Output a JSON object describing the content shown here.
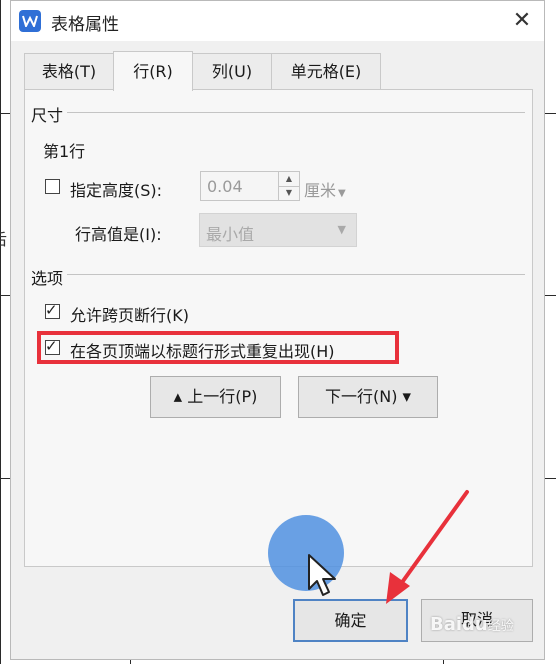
{
  "dialog": {
    "title": "表格属性",
    "app_icon": "wps-writer-icon",
    "close_glyph": "✕"
  },
  "tabs": [
    {
      "label": "表格(T)",
      "active": false
    },
    {
      "label": "行(R)",
      "active": true
    },
    {
      "label": "列(U)",
      "active": false
    },
    {
      "label": "单元格(E)",
      "active": false
    }
  ],
  "size_section": {
    "title": "尺寸",
    "row_label": "第1行",
    "specify_height": {
      "label": "指定高度(S):",
      "checked": false
    },
    "height_value": "0.04",
    "unit": "厘米",
    "row_height_mode": {
      "label": "行高值是(I):",
      "value": "最小值"
    }
  },
  "options_section": {
    "title": "选项",
    "allow_break": {
      "label": "允许跨页断行(K)",
      "checked": true
    },
    "repeat_header": {
      "label": "在各页顶端以标题行形式重复出现(H)",
      "checked": true
    }
  },
  "nav": {
    "prev_label": "上一行(P)",
    "prev_glyph": "▲",
    "next_label": "下一行(N)",
    "next_glyph": "▼"
  },
  "footer": {
    "ok_label": "确定",
    "cancel_label": "取消"
  },
  "background": {
    "partial_glyph": "后"
  },
  "watermark": {
    "brand": "Bai",
    "brand2": "经验",
    "paw": "du"
  },
  "colors": {
    "highlight": "#e8313b",
    "accent": "#4f83c4",
    "pointer_halo": "#5091e1"
  }
}
